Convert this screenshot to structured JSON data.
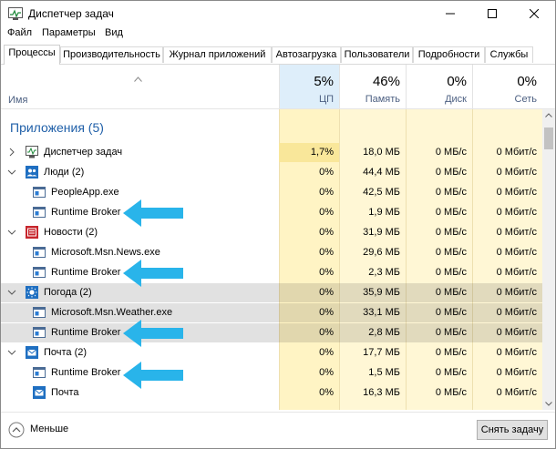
{
  "window": {
    "title": "Диспетчер задач"
  },
  "menu": [
    "Файл",
    "Параметры",
    "Вид"
  ],
  "tabs": [
    "Процессы",
    "Производительность",
    "Журнал приложений",
    "Автозагрузка",
    "Пользователи",
    "Подробности",
    "Службы"
  ],
  "columns": {
    "name": "Имя",
    "cpu": {
      "pct": "5%",
      "label": "ЦП"
    },
    "mem": {
      "pct": "46%",
      "label": "Память"
    },
    "disk": {
      "pct": "0%",
      "label": "Диск"
    },
    "net": {
      "pct": "0%",
      "label": "Сеть"
    }
  },
  "group": {
    "title": "Приложения (5)"
  },
  "rows": [
    {
      "name": "Диспетчер задач",
      "cpu": "1,7%",
      "mem": "18,0 МБ",
      "disk": "0 МБ/с",
      "net": "0 Мбит/с",
      "icon": "task-manager-icon"
    },
    {
      "name": "Люди (2)",
      "cpu": "0%",
      "mem": "44,4 МБ",
      "disk": "0 МБ/с",
      "net": "0 Мбит/с",
      "icon": "people-icon"
    },
    {
      "name": "PeopleApp.exe",
      "cpu": "0%",
      "mem": "42,5 МБ",
      "disk": "0 МБ/с",
      "net": "0 Мбит/с",
      "icon": "process-icon"
    },
    {
      "name": "Runtime Broker",
      "cpu": "0%",
      "mem": "1,9 МБ",
      "disk": "0 МБ/с",
      "net": "0 Мбит/с",
      "icon": "process-icon"
    },
    {
      "name": "Новости (2)",
      "cpu": "0%",
      "mem": "31,9 МБ",
      "disk": "0 МБ/с",
      "net": "0 Мбит/с",
      "icon": "news-icon"
    },
    {
      "name": "Microsoft.Msn.News.exe",
      "cpu": "0%",
      "mem": "29,6 МБ",
      "disk": "0 МБ/с",
      "net": "0 Мбит/с",
      "icon": "process-icon"
    },
    {
      "name": "Runtime Broker",
      "cpu": "0%",
      "mem": "2,3 МБ",
      "disk": "0 МБ/с",
      "net": "0 Мбит/с",
      "icon": "process-icon"
    },
    {
      "name": "Погода (2)",
      "cpu": "0%",
      "mem": "35,9 МБ",
      "disk": "0 МБ/с",
      "net": "0 Мбит/с",
      "icon": "weather-icon"
    },
    {
      "name": "Microsoft.Msn.Weather.exe",
      "cpu": "0%",
      "mem": "33,1 МБ",
      "disk": "0 МБ/с",
      "net": "0 Мбит/с",
      "icon": "process-icon"
    },
    {
      "name": "Runtime Broker",
      "cpu": "0%",
      "mem": "2,8 МБ",
      "disk": "0 МБ/с",
      "net": "0 Мбит/с",
      "icon": "process-icon"
    },
    {
      "name": "Почта (2)",
      "cpu": "0%",
      "mem": "17,7 МБ",
      "disk": "0 МБ/с",
      "net": "0 Мбит/с",
      "icon": "mail-icon"
    },
    {
      "name": "Runtime Broker",
      "cpu": "0%",
      "mem": "1,5 МБ",
      "disk": "0 МБ/с",
      "net": "0 Мбит/с",
      "icon": "process-icon"
    },
    {
      "name": "Почта",
      "cpu": "0%",
      "mem": "16,3 МБ",
      "disk": "0 МБ/с",
      "net": "0 Мбит/с",
      "icon": "mail-icon"
    }
  ],
  "footer": {
    "less": "Меньше",
    "end_task": "Снять задачу"
  },
  "colors": {
    "accent": "#1f5fa8",
    "highlight_col": "#fff7d5",
    "header_hl": "#deeefa",
    "arrow": "#29b4ea"
  }
}
